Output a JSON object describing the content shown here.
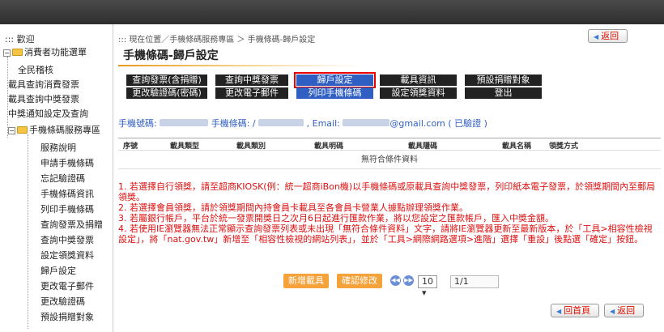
{
  "sidebar": {
    "welcome": "::: 歡迎",
    "root": "消費者功能選單",
    "items": [
      "全民稽核",
      "載具查詢消費發票",
      "載具查詢中獎發票",
      "中獎通知設定及查詢"
    ],
    "sub_root": "手機條碼服務專區",
    "sub_items": [
      "服務說明",
      "申請手機條碼",
      "忘記驗證碼",
      "手機條碼資訊",
      "列印手機條碼",
      "查詢發票及捐贈",
      "查詢中獎發票",
      "設定領獎資料",
      "歸戶設定",
      "更改電子郵件",
      "更改驗證碼",
      "預設捐贈對象"
    ]
  },
  "breadcrumb": "::: 現在位置／手機條碼服務專區 ＞ 手機條碼-歸戶設定",
  "back_label": "返回",
  "page_title": "手機條碼-歸戶設定",
  "nav": {
    "row1": [
      "查詢發票(含捐贈)",
      "查詢中獎發票",
      "歸戶設定",
      "載具資訊",
      "預設捐贈對象"
    ],
    "row2": [
      "更改驗證碼(密碼)",
      "更改電子郵件",
      "列印手機條碼",
      "設定領獎資料",
      "登出"
    ]
  },
  "info": {
    "phone_label": "手機號碼:",
    "barcode_label": "手機條碼: /",
    "email_label": ", Email:",
    "email_suffix": "@gmail.com ( 已驗證 )"
  },
  "table": {
    "headers": [
      "序號",
      "載具類型",
      "載具類別",
      "載具明碼",
      "載具隱碼",
      "載具名稱",
      "領獎方式"
    ],
    "empty": "無符合條件資料"
  },
  "notes": [
    "1. 若選擇自行領獎，請至超商KIOSK(例：統一超商iBon機)以手機條碼或原載具查詢中獎發票，列印紙本電子發票，於領獎期間內至郵局領獎。",
    "2. 若選擇會員領獎，請於領獎期間內持會員卡載具至各會員卡營業人據點辦理領獎作業。",
    "3. 若屬銀行帳戶，平台於統一發票開獎日之次月6日起進行匯款作業，將以您設定之匯款帳戶，匯入中獎金額。",
    "4. 若使用IE瀏覽器無法正常顯示查詢發票列表或未出現「無符合條件資料」文字，請將IE瀏覽器更新至最新版本，於「工具>相容性檢視設定」，將「nat.gov.tw」新增至「相容性檢視的網站列表」，並於「工具>網際網路選項>進階」選擇「重設」後點選「確定」按鈕。"
  ],
  "pager": {
    "add_label": "新增載具",
    "confirm_label": "確認修改",
    "page_size": "10 ▾",
    "page_info": "1/1"
  },
  "bottom": {
    "home_label": "回首頁",
    "back_label": "返回"
  },
  "colors": {
    "accent": "#2f5fc2",
    "warning": "#dd1111",
    "button_orange": "#f5a23a"
  }
}
